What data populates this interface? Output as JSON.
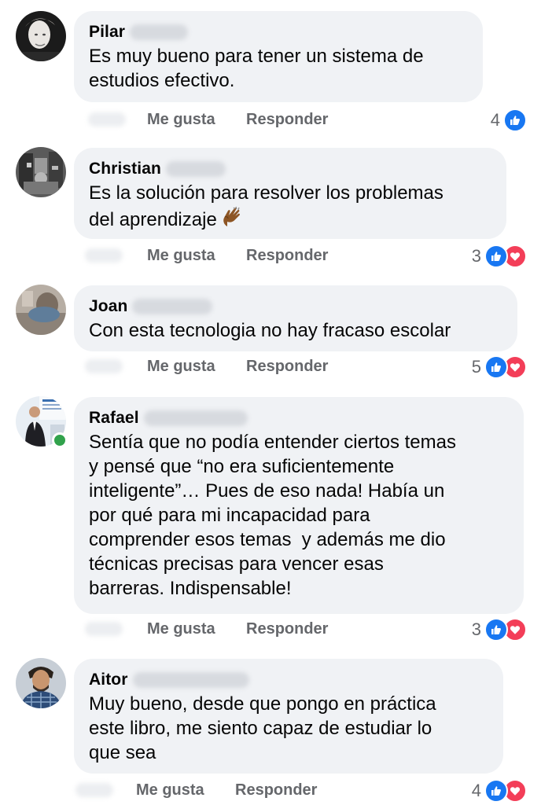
{
  "comments": [
    {
      "author": "Pilar",
      "text": "Es muy bueno para tener un sistema de\nestudios efectivo.",
      "like_label": "Me gusta",
      "reply_label": "Responder",
      "reaction_count": "4",
      "reactions": [
        "like"
      ],
      "avatar": "profile-photo"
    },
    {
      "author": "Christian",
      "text": "Es la solución para resolver los problemas\ndel aprendizaje",
      "emoji": "clapping-hands",
      "like_label": "Me gusta",
      "reply_label": "Responder",
      "reaction_count": "3",
      "reactions": [
        "like",
        "love"
      ],
      "avatar": "profile-photo"
    },
    {
      "author": "Joan",
      "text": "Con esta tecnologia no hay fracaso escolar",
      "like_label": "Me gusta",
      "reply_label": "Responder",
      "reaction_count": "5",
      "reactions": [
        "like",
        "love"
      ],
      "avatar": "profile-photo"
    },
    {
      "author": "Rafael",
      "text": "Sentía que no podía entender ciertos temas\ny pensé que “no era suficientemente\ninteligente”… Pues de eso nada! Había un\npor qué para mi incapacidad para\ncomprender esos temas  y además me dio\ntécnicas precisas para vencer esas\nbarreras. Indispensable!",
      "like_label": "Me gusta",
      "reply_label": "Responder",
      "reaction_count": "3",
      "reactions": [
        "like",
        "love"
      ],
      "avatar": "profile-photo",
      "online": true
    },
    {
      "author": "Aitor",
      "text": "Muy bueno, desde que pongo en práctica\neste libro, me siento capaz de estudiar lo\nque sea",
      "like_label": "Me gusta",
      "reply_label": "Responder",
      "reaction_count": "4",
      "reactions": [
        "like",
        "love"
      ],
      "avatar": "profile-photo"
    }
  ],
  "colors": {
    "bubble_bg": "#f0f2f5",
    "action_text": "#65676b",
    "like_blue": "#1877f2",
    "love_red": "#f33e58",
    "online_green": "#31a24c"
  }
}
